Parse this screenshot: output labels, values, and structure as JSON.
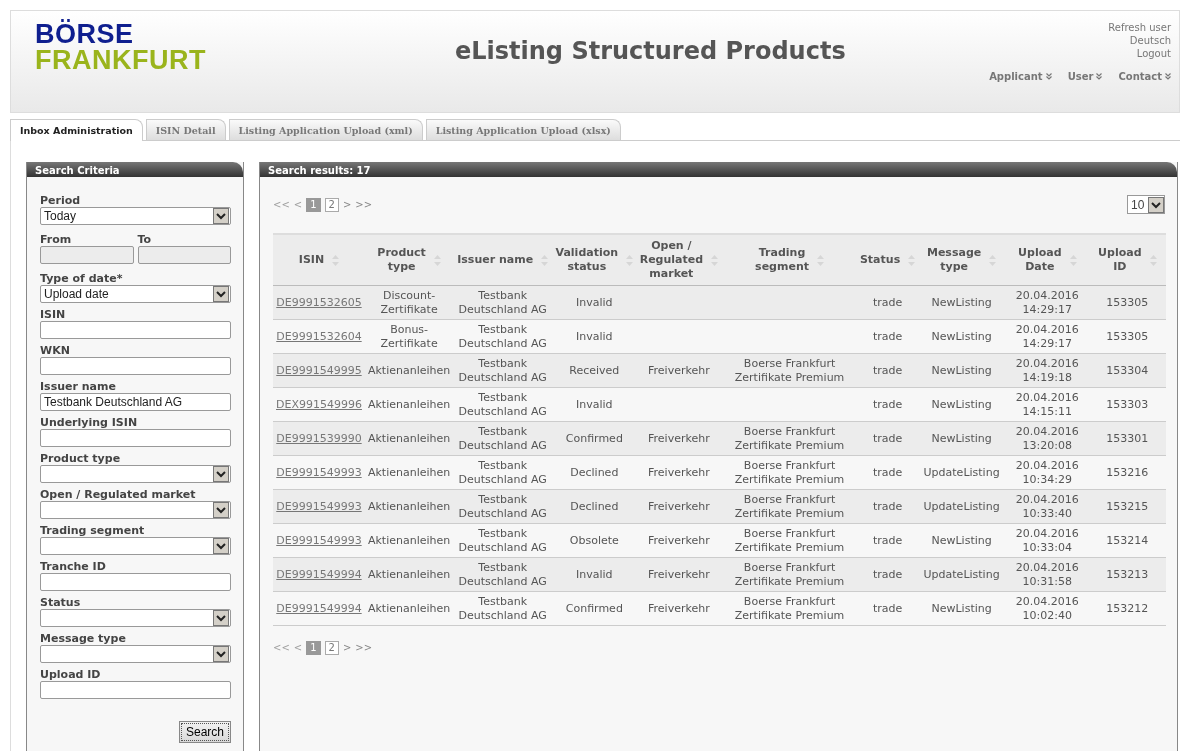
{
  "header": {
    "logo": [
      "BÖRSE",
      "FRANKFURT"
    ],
    "title": "eListing Structured Products",
    "links": [
      "Refresh user",
      "Deutsch",
      "Logout"
    ],
    "menus": [
      "Applicant",
      "User",
      "Contact"
    ]
  },
  "tabs": [
    {
      "label": "Inbox Administration",
      "selected": true
    },
    {
      "label": "ISIN Detail",
      "selected": false
    },
    {
      "label": "Listing Application Upload (xml)",
      "selected": false
    },
    {
      "label": "Listing Application Upload (xlsx)",
      "selected": false
    }
  ],
  "search_criteria": {
    "title": "Search Criteria",
    "fields": [
      {
        "kind": "select",
        "label": "Period",
        "value": "Today"
      },
      {
        "kind": "range",
        "labels": [
          "From",
          "To"
        ]
      },
      {
        "kind": "select",
        "label": "Type of date*",
        "value": "Upload date"
      },
      {
        "kind": "input",
        "label": "ISIN"
      },
      {
        "kind": "input",
        "label": "WKN"
      },
      {
        "kind": "input",
        "label": "Issuer name",
        "value": "Testbank Deutschland AG"
      },
      {
        "kind": "input",
        "label": "Underlying ISIN"
      },
      {
        "kind": "select",
        "label": "Product type"
      },
      {
        "kind": "select",
        "label": "Open / Regulated market"
      },
      {
        "kind": "select",
        "label": "Trading segment"
      },
      {
        "kind": "input",
        "label": "Tranche ID"
      },
      {
        "kind": "select",
        "label": "Status"
      },
      {
        "kind": "select",
        "label": "Message type"
      },
      {
        "kind": "input",
        "label": "Upload ID"
      }
    ],
    "button": "Search"
  },
  "results": {
    "title": "Search results: 17",
    "page_size": "10",
    "pagination": [
      {
        "first": "<<",
        "prev": "<",
        "pages": [
          {
            "label": "1",
            "selected": true
          },
          {
            "label": "2",
            "selected": false
          }
        ],
        "next": ">",
        "last": ">>",
        "first_disabled": true
      },
      {
        "first": "<<",
        "prev": "<",
        "pages": [
          {
            "label": "1",
            "selected": true
          },
          {
            "label": "2",
            "selected": false
          }
        ],
        "next": ">",
        "last": ">>",
        "first_disabled": true
      }
    ],
    "columns": [
      "ISIN",
      "Product\ntype",
      "Issuer name",
      "Validation\nstatus",
      "Open /\nRegulated\nmarket",
      "Trading\nsegment",
      "Status",
      "Message\ntype",
      "Upload\nDate",
      "Upload\nID"
    ],
    "rows": [
      [
        "DE9991532605",
        "Discount-\nZertifikate",
        "Testbank\nDeutschland AG",
        "Invalid",
        "",
        "",
        "trade",
        "NewListing",
        "20.04.2016\n14:29:17",
        "153305"
      ],
      [
        "DE9991532604",
        "Bonus-\nZertifikate",
        "Testbank\nDeutschland AG",
        "Invalid",
        "",
        "",
        "trade",
        "NewListing",
        "20.04.2016\n14:29:17",
        "153305"
      ],
      [
        "DE9991549995",
        "Aktienanleihen",
        "Testbank\nDeutschland AG",
        "Received",
        "Freiverkehr",
        "Boerse Frankfurt\nZertifikate Premium",
        "trade",
        "NewListing",
        "20.04.2016\n14:19:18",
        "153304"
      ],
      [
        "DEX991549996",
        "Aktienanleihen",
        "Testbank\nDeutschland AG",
        "Invalid",
        "",
        "",
        "trade",
        "NewListing",
        "20.04.2016\n14:15:11",
        "153303"
      ],
      [
        "DE9991539990",
        "Aktienanleihen",
        "Testbank\nDeutschland AG",
        "Confirmed",
        "Freiverkehr",
        "Boerse Frankfurt\nZertifikate Premium",
        "trade",
        "NewListing",
        "20.04.2016\n13:20:08",
        "153301"
      ],
      [
        "DE9991549993",
        "Aktienanleihen",
        "Testbank\nDeutschland AG",
        "Declined",
        "Freiverkehr",
        "Boerse Frankfurt\nZertifikate Premium",
        "trade",
        "UpdateListing",
        "20.04.2016\n10:34:29",
        "153216"
      ],
      [
        "DE9991549993",
        "Aktienanleihen",
        "Testbank\nDeutschland AG",
        "Declined",
        "Freiverkehr",
        "Boerse Frankfurt\nZertifikate Premium",
        "trade",
        "UpdateListing",
        "20.04.2016\n10:33:40",
        "153215"
      ],
      [
        "DE9991549993",
        "Aktienanleihen",
        "Testbank\nDeutschland AG",
        "Obsolete",
        "Freiverkehr",
        "Boerse Frankfurt\nZertifikate Premium",
        "trade",
        "NewListing",
        "20.04.2016\n10:33:04",
        "153214"
      ],
      [
        "DE9991549994",
        "Aktienanleihen",
        "Testbank\nDeutschland AG",
        "Invalid",
        "Freiverkehr",
        "Boerse Frankfurt\nZertifikate Premium",
        "trade",
        "UpdateListing",
        "20.04.2016\n10:31:58",
        "153213"
      ],
      [
        "DE9991549994",
        "Aktienanleihen",
        "Testbank\nDeutschland AG",
        "Confirmed",
        "Freiverkehr",
        "Boerse Frankfurt\nZertifikate Premium",
        "trade",
        "NewListing",
        "20.04.2016\n10:02:40",
        "153212"
      ]
    ]
  }
}
